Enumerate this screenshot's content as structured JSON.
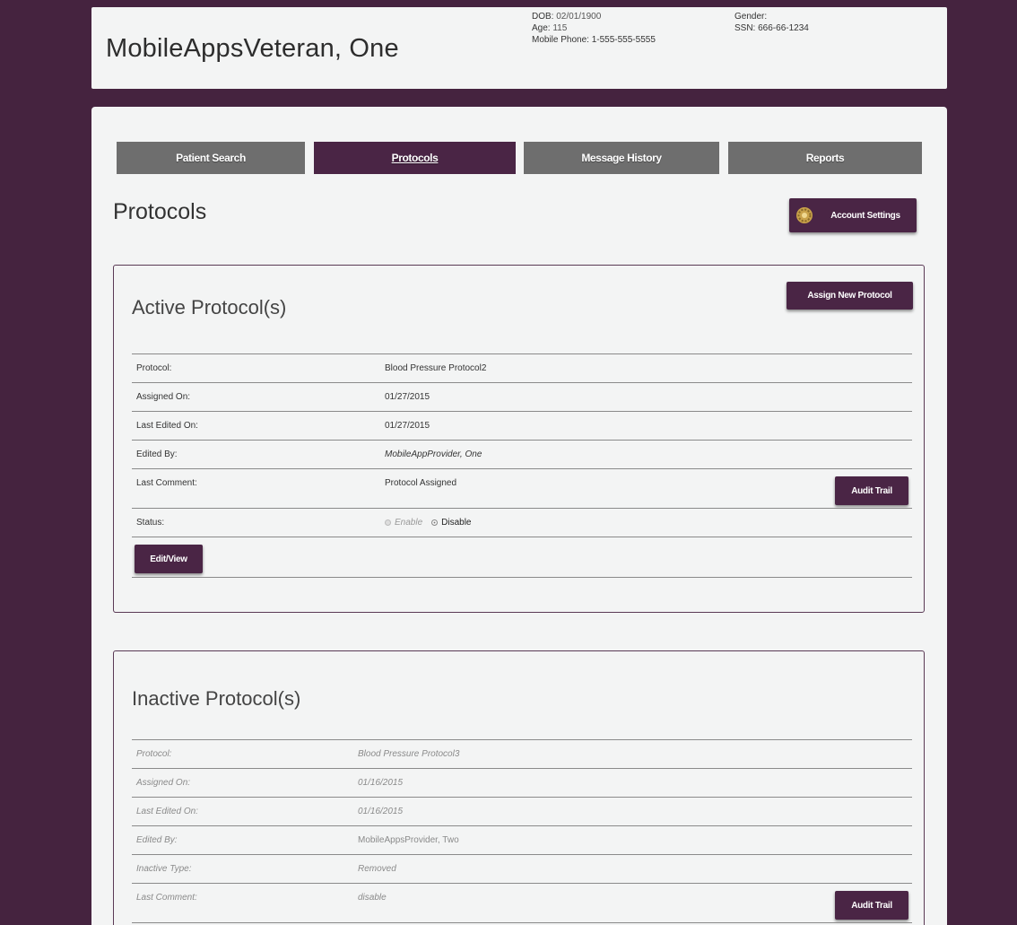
{
  "patient": {
    "name": "MobileAppsVeteran, One",
    "dob_label": "DOB:",
    "dob": "02/01/1900",
    "age_label": "Age:",
    "age": "115",
    "phone_label": "Mobile Phone:",
    "phone": "1-555-555-5555",
    "gender_label": "Gender:",
    "gender": "",
    "ssn_label": "SSN:",
    "ssn": "666-66-1234"
  },
  "tabs": [
    {
      "label": "Patient Search",
      "active": false
    },
    {
      "label": "Protocols",
      "active": true
    },
    {
      "label": "Message History",
      "active": false
    },
    {
      "label": "Reports",
      "active": false
    }
  ],
  "page_title": "Protocols",
  "account_settings_label": "Account Settings",
  "accent_color": "#4a2545",
  "background_color": "#45233f",
  "active_panel": {
    "title": "Active Protocol(s)",
    "assign_label": "Assign New Protocol",
    "rows": [
      {
        "key": "Protocol:",
        "value": "Blood Pressure Protocol2"
      },
      {
        "key": "Assigned On:",
        "value": "01/27/2015"
      },
      {
        "key": "Last Edited On:",
        "value": "01/27/2015"
      },
      {
        "key": "Edited By:",
        "value": "MobileAppProvider, One"
      },
      {
        "key": "Last Comment:",
        "value": "Protocol Assigned"
      },
      {
        "key": "Status:",
        "value": ""
      }
    ],
    "audit_label": "Audit Trail",
    "status_enable": "Enable",
    "status_disable": "Disable",
    "status_selected": "Disable",
    "edit_label": "Edit/View"
  },
  "inactive_panel": {
    "title": "Inactive Protocol(s)",
    "rows": [
      {
        "key": "Protocol:",
        "value": "Blood Pressure Protocol3"
      },
      {
        "key": "Assigned On:",
        "value": "01/16/2015"
      },
      {
        "key": "Last Edited On:",
        "value": "01/16/2015"
      },
      {
        "key": "Edited By:",
        "value": "MobileAppsProvider, Two"
      },
      {
        "key": "Inactive Type:",
        "value": "Removed"
      },
      {
        "key": "Last Comment:",
        "value": "disable"
      }
    ],
    "audit_label": "Audit Trail"
  }
}
